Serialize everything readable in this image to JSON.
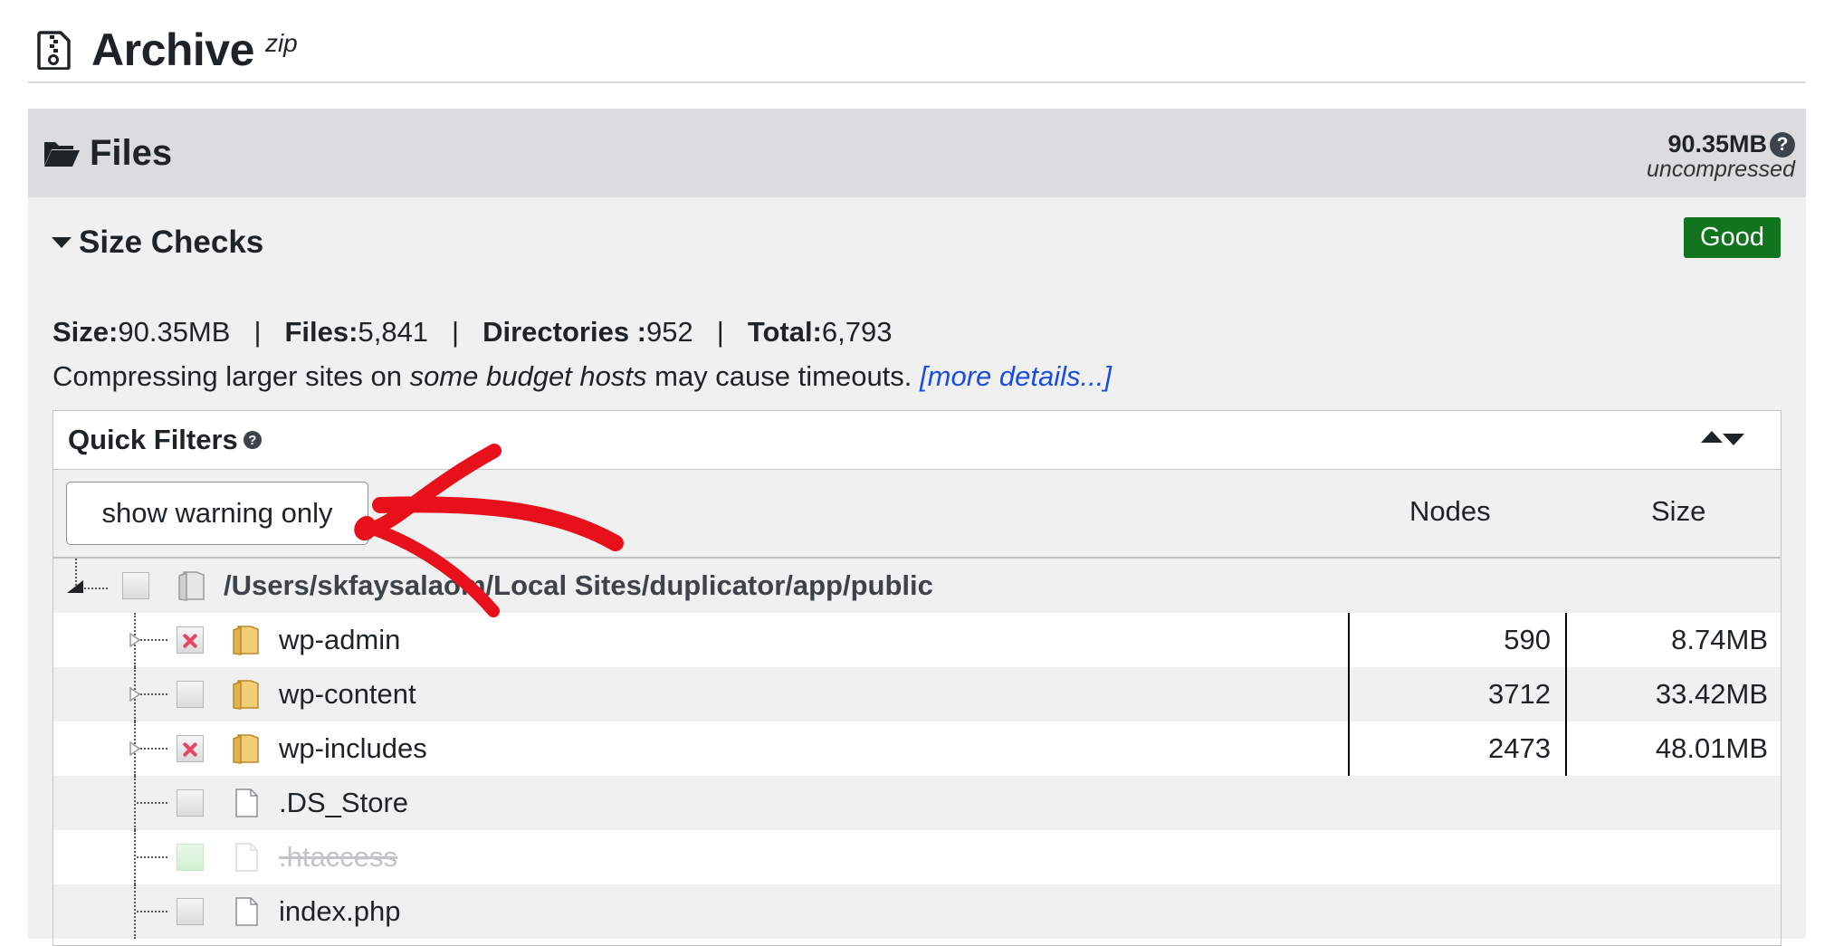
{
  "archive": {
    "title": "Archive",
    "sub": "zip"
  },
  "files": {
    "title": "Files",
    "total_size": "90.35MB",
    "total_size_note": "uncompressed",
    "help": "?"
  },
  "size_checks": {
    "title": "Size Checks",
    "status": "Good"
  },
  "stats": {
    "size_label": "Size:",
    "size_value": "90.35MB",
    "files_label": "Files:",
    "files_value": "5,841",
    "dirs_label": "Directories :",
    "dirs_value": "952",
    "total_label": "Total:",
    "total_value": "6,793",
    "separator": "|"
  },
  "note": {
    "prefix": "Compressing larger sites on ",
    "emphasis": "some budget hosts",
    "suffix": " may cause timeouts. ",
    "link": "[more details...]"
  },
  "quick_filters": {
    "title": "Quick Filters",
    "help": "?"
  },
  "table": {
    "button": "show warning only",
    "col_nodes": "Nodes",
    "col_size": "Size",
    "root_path": "/Users/skfaysalaom/Local Sites/duplicator/app/public",
    "rows": [
      {
        "name": "wp-admin",
        "nodes": "590",
        "size": "8.74MB",
        "type": "folder",
        "flag": "excluded"
      },
      {
        "name": "wp-content",
        "nodes": "3712",
        "size": "33.42MB",
        "type": "folder",
        "flag": "normal"
      },
      {
        "name": "wp-includes",
        "nodes": "2473",
        "size": "48.01MB",
        "type": "folder",
        "flag": "excluded"
      },
      {
        "name": ".DS_Store",
        "type": "file",
        "flag": "normal"
      },
      {
        "name": ".htaccess",
        "type": "file",
        "flag": "filtered"
      },
      {
        "name": "index.php",
        "type": "file",
        "flag": "normal"
      }
    ]
  },
  "colors": {
    "good": "#10751d",
    "link": "#1a4dde",
    "arrow": "#e8101b",
    "excluded": "#e5485f"
  }
}
